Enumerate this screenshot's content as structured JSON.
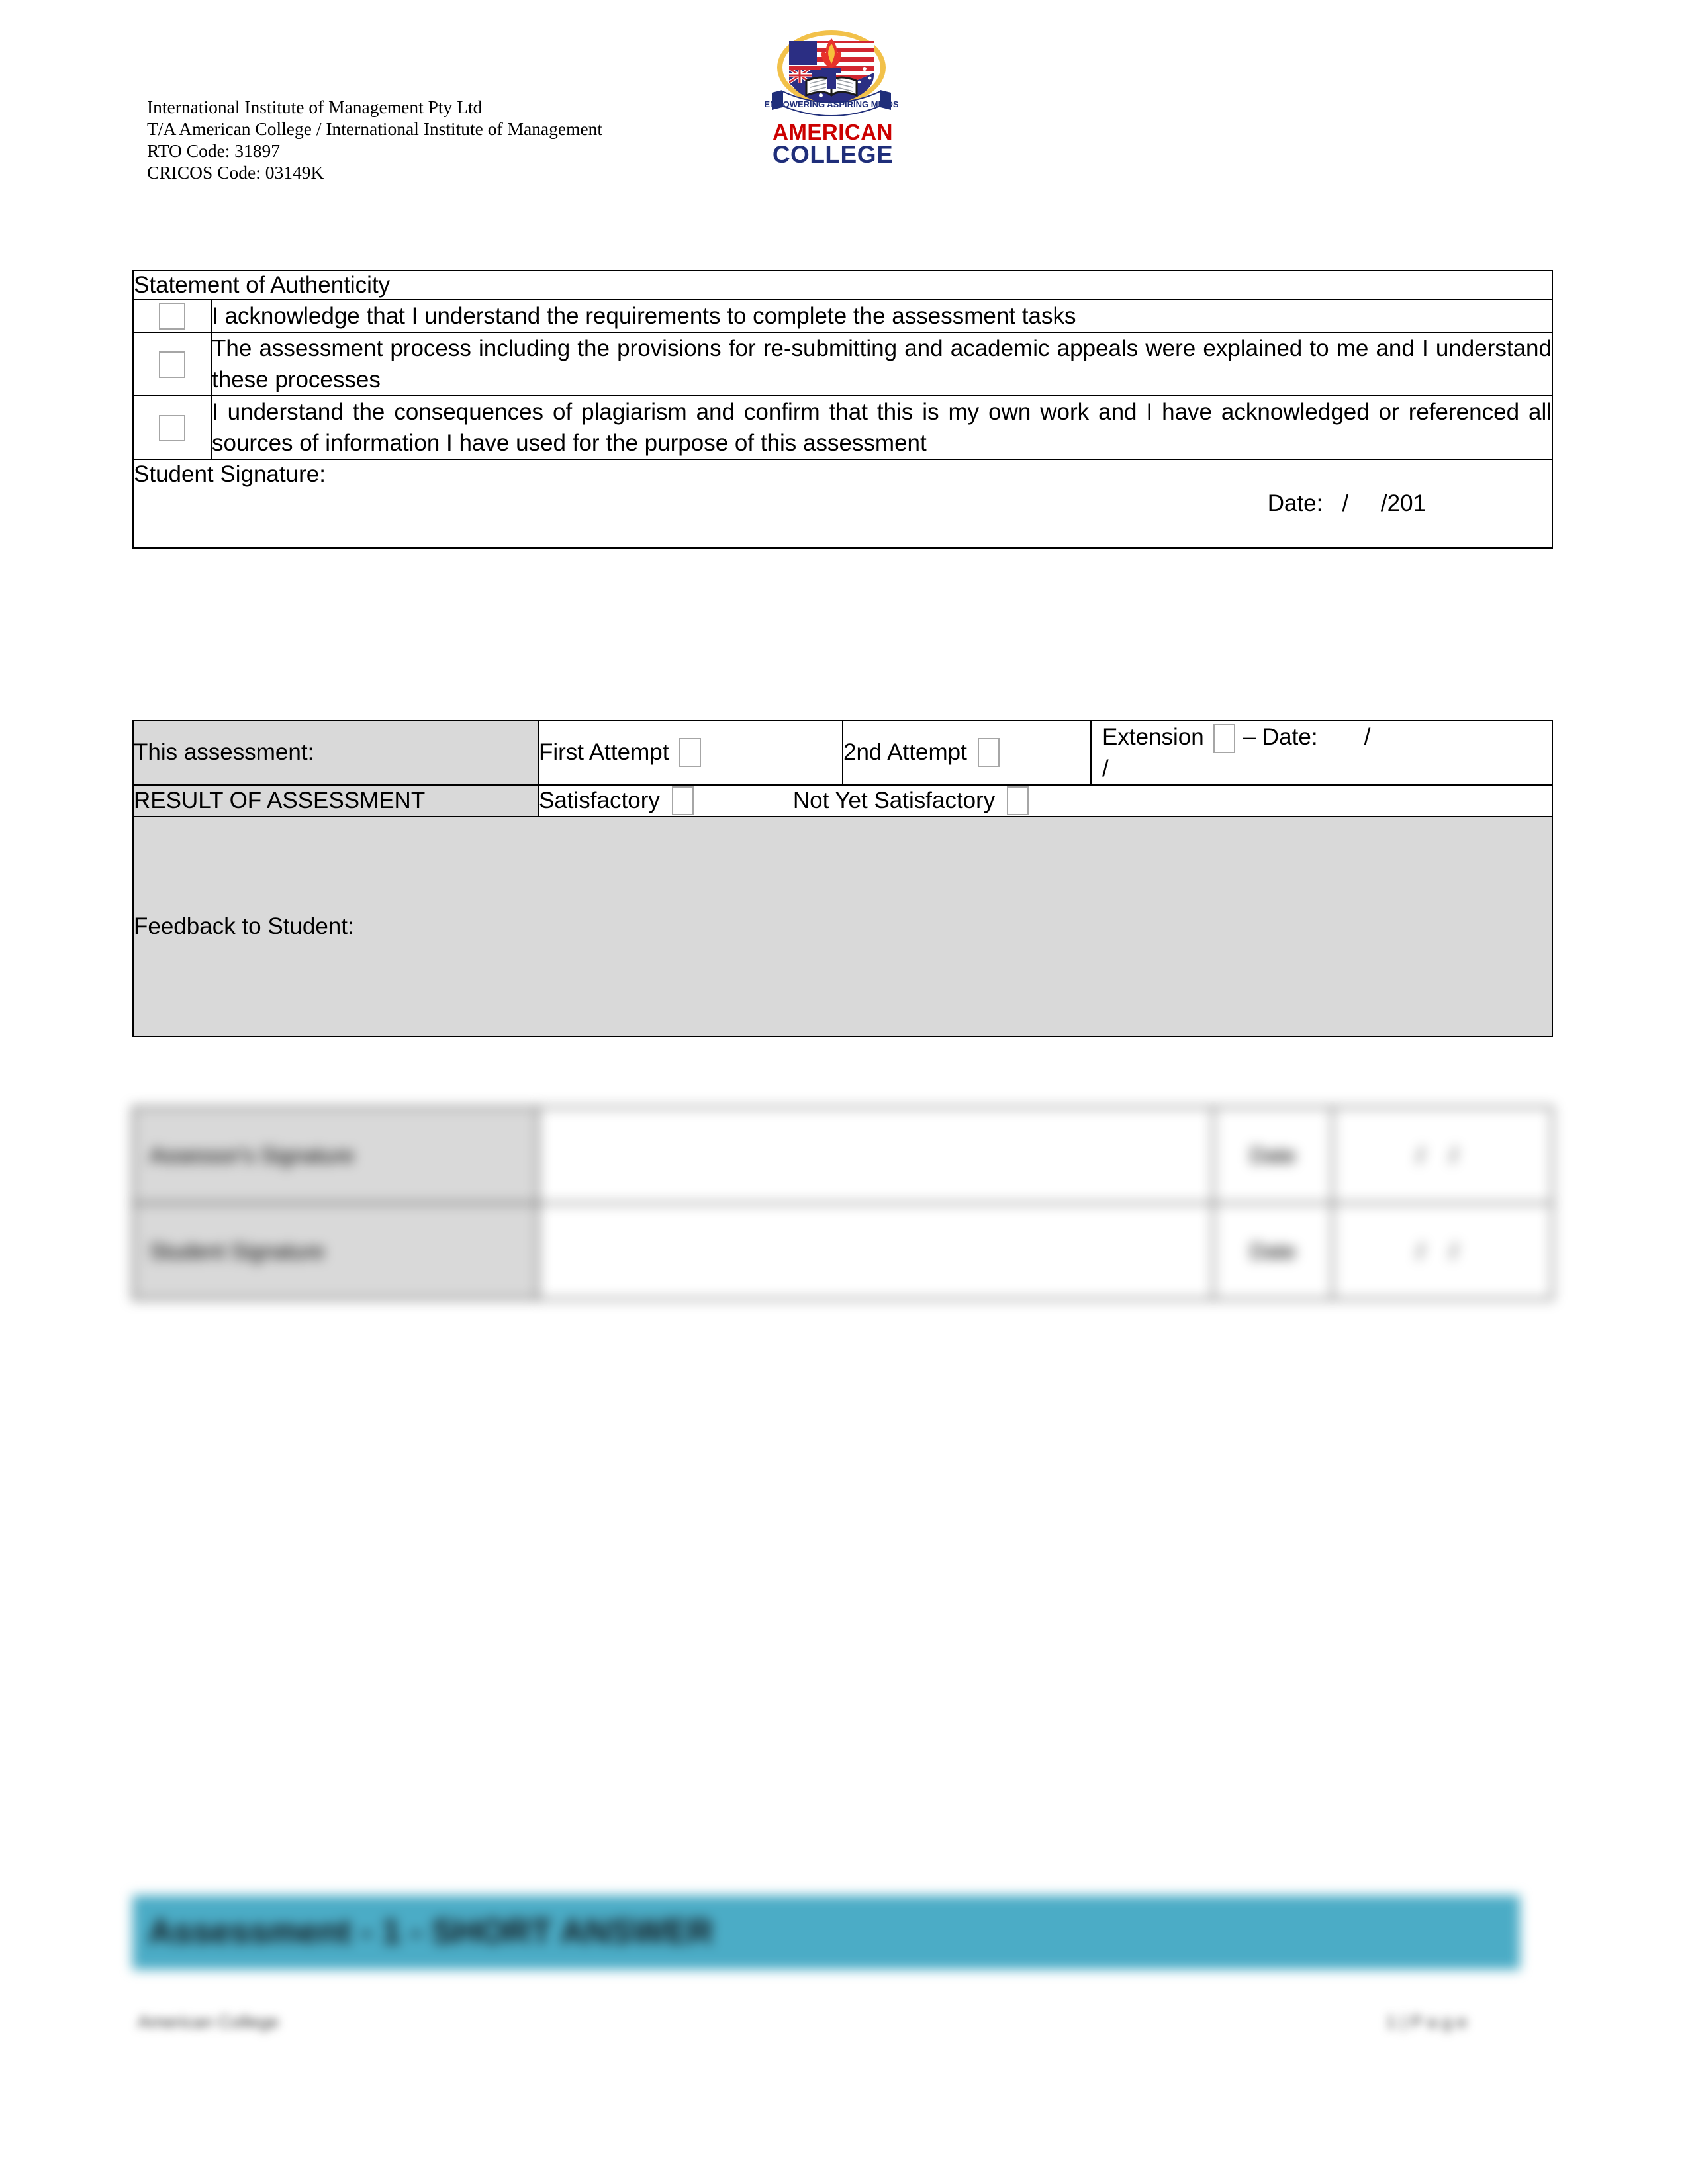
{
  "document": {
    "page_background": "#ffffff",
    "accent_banner_color": "#4BACC6",
    "table_shade_color": "#D9D9D9",
    "checkbox_border_color": "#A6A6A6"
  },
  "header": {
    "lines": [
      "International Institute of Management Pty Ltd",
      "T/A American College / International Institute of Management",
      "RTO Code: 31897",
      "CRICOS Code: 03149K"
    ],
    "line1": "International Institute of Management Pty Ltd",
    "line2": "T/A American College / International Institute of Management",
    "line3": "RTO Code: 31897",
    "line4": "CRICOS Code: 03149K"
  },
  "logo": {
    "name": "american-college-crest-logo",
    "banner_motto": "EMPOWERING ASPIRING MINDS",
    "word_top": "AMERICAN",
    "word_bottom": "COLLEGE",
    "color_top": "#CC0000",
    "color_bottom": "#1F2E7A"
  },
  "statement_table": {
    "title": "Statement of Authenticity",
    "rows": [
      {
        "checkbox": "unchecked",
        "text": "I acknowledge that I understand the requirements to complete the assessment tasks"
      },
      {
        "checkbox": "unchecked",
        "text": "The assessment process including the provisions for re-submitting and academic appeals were explained to me and I understand these processes"
      },
      {
        "checkbox": "unchecked",
        "text": "I understand the consequences of plagiarism and confirm that this is my own work and I have acknowledged or referenced all sources of information I have used for the purpose of this assessment"
      }
    ],
    "signature_label": "Student Signature:",
    "date_label": "Date:",
    "date_value": "/     /201"
  },
  "result_table": {
    "assessment_label": "This assessment:",
    "first_attempt_label": "First Attempt",
    "first_attempt_checkbox": "unchecked",
    "second_attempt_label": "2nd Attempt",
    "second_attempt_checkbox": "unchecked",
    "extension_label": "Extension",
    "extension_checkbox": "unchecked",
    "extension_date_label": "– Date:",
    "extension_date_value": "/",
    "extension_date_value2": "/",
    "result_label": "RESULT OF ASSESSMENT",
    "satisfactory_label": "Satisfactory",
    "satisfactory_checkbox": "unchecked",
    "not_yet_satisfactory_label": "Not Yet Satisfactory",
    "not_yet_satisfactory_checkbox": "unchecked",
    "feedback_label": "Feedback to Student:",
    "feedback_value": ""
  },
  "signature_rows": {
    "note": "rendered blurred in the source image",
    "assessor_label": "Assessor's Signature",
    "assessor_value": "",
    "assessor_date_label": "Date",
    "assessor_date_value": "/      /",
    "student_label": "Student Signature",
    "student_value": "",
    "student_date_label": "Date",
    "student_date_value": "/      /"
  },
  "banner": {
    "title": "Assessment - 1 - SHORT ANSWER"
  },
  "footer": {
    "left": "American College",
    "right": "1 | P a g e"
  }
}
